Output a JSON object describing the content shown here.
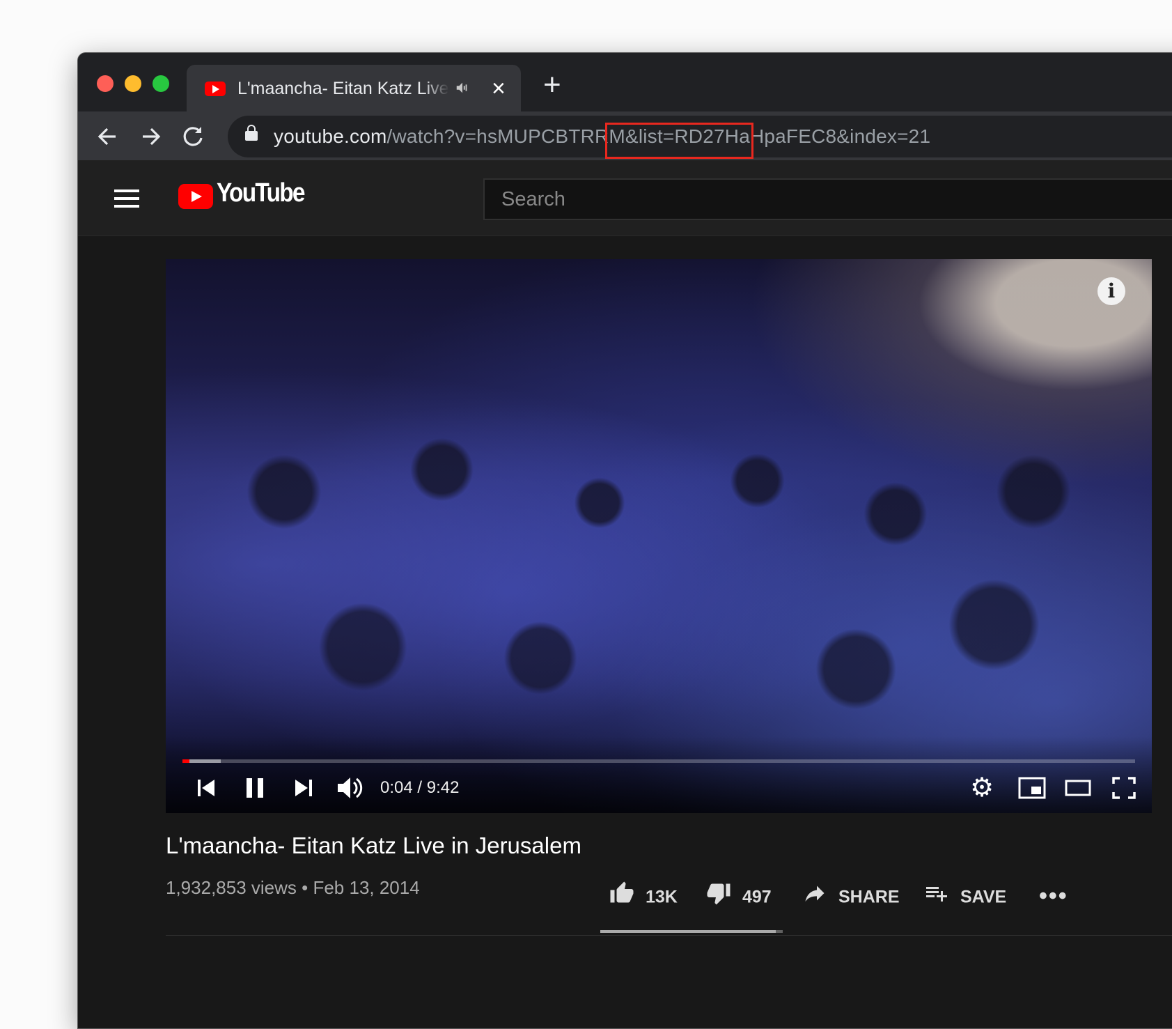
{
  "browser": {
    "tab": {
      "title": "L'maancha- Eitan Katz Live in Jerusalem",
      "audio_icon": "speaker-icon"
    },
    "new_tab_label": "+",
    "url": {
      "host": "youtube.com",
      "path": "/watch?v=hsMUPCBTRRM&list=RD27HaHpaFEC8&index=21",
      "highlighted_segment": "hsMUPCBTRRM"
    }
  },
  "youtube": {
    "logo_text": "YouTube",
    "search_placeholder": "Search",
    "player": {
      "time": "0:04 / 9:42",
      "progress_fraction": 0.007,
      "buffered_fraction": 0.04,
      "info_label": "i"
    },
    "video": {
      "title": "L'maancha- Eitan Katz Live in Jerusalem",
      "meta": "1,932,853 views • Feb 13, 2014",
      "likes": "13K",
      "dislikes": "497",
      "share_label": "SHARE",
      "save_label": "SAVE",
      "more_label": "•••",
      "like_ratio": 0.96
    }
  },
  "colors": {
    "brand_red": "#ff0000",
    "highlight_box": "#e8281f"
  }
}
